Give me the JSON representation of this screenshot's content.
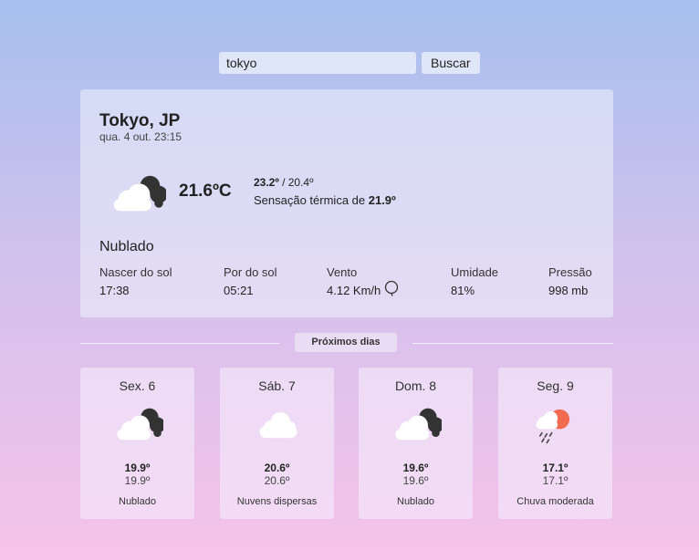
{
  "search": {
    "value": "tokyo",
    "button_label": "Buscar"
  },
  "current": {
    "city": "Tokyo, JP",
    "datetime": "qua. 4 out. 23:15",
    "temperature": "21.6ºC",
    "high": "23.2º",
    "low": " / 20.4º",
    "feels_like_label": "Sensação térmica de ",
    "feels_like_value": "21.9º",
    "condition": "Nublado",
    "icon": "cloudy-icon",
    "stats": [
      {
        "label": "Nascer do sol",
        "value": "17:38"
      },
      {
        "label": "Por do sol",
        "value": "05:21"
      },
      {
        "label": "Vento",
        "value": "4.12 Km/h"
      },
      {
        "label": "Umidade",
        "value": "81%"
      },
      {
        "label": "Pressão",
        "value": "998 mb"
      }
    ]
  },
  "forecast_title": "Próximos dias",
  "forecast": [
    {
      "day": "Sex. 6",
      "max": "19.9º",
      "min": "19.9º",
      "desc": "Nublado",
      "icon": "cloudy-icon"
    },
    {
      "day": "Sáb. 7",
      "max": "20.6º",
      "min": "20.6º",
      "desc": "Nuvens dispersas",
      "icon": "cloud-icon"
    },
    {
      "day": "Dom. 8",
      "max": "19.6º",
      "min": "19.6º",
      "desc": "Nublado",
      "icon": "cloudy-icon"
    },
    {
      "day": "Seg. 9",
      "max": "17.1º",
      "min": "17.1º",
      "desc": "Chuva moderada",
      "icon": "rain-sun-icon"
    }
  ],
  "colors": {
    "accent_sun": "#f26b4f",
    "cloud_dark": "#333333",
    "cloud_light": "#ffffff"
  }
}
